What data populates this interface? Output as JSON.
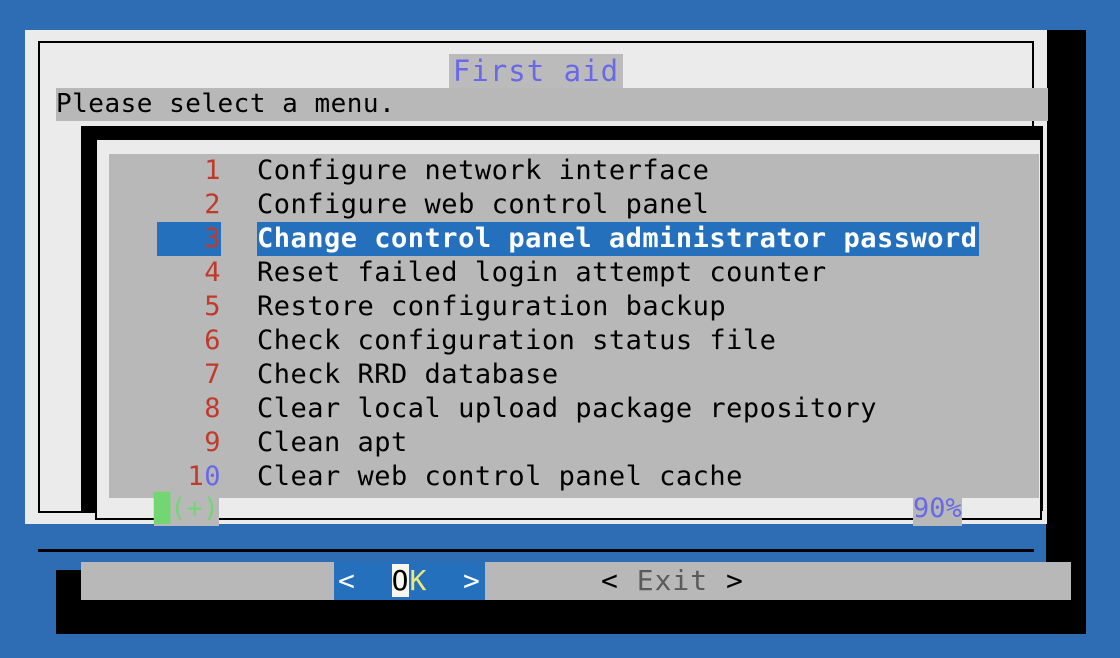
{
  "window": {
    "title": "First aid",
    "prompt": "Please select a menu."
  },
  "colors": {
    "desktop_blue": "#2e6db4",
    "dialog_bg": "#ebebeb",
    "panel_gray": "#b8b8b8",
    "accent_blue": "#2470bd",
    "number_red": "#c03a2b",
    "title_blue": "#6868e8",
    "scroll_green": "#73d673",
    "hotkey_yellow": "#ede87a"
  },
  "menu": {
    "selected_index": 2,
    "items": [
      {
        "number": "1",
        "label": "Configure network interface"
      },
      {
        "number": "2",
        "label": "Configure web control panel"
      },
      {
        "number": "3",
        "label": "Change control panel administrator password"
      },
      {
        "number": "4",
        "label": "Reset failed login attempt counter"
      },
      {
        "number": "5",
        "label": "Restore configuration backup"
      },
      {
        "number": "6",
        "label": "Check configuration status file"
      },
      {
        "number": "7",
        "label": "Check RRD database"
      },
      {
        "number": "8",
        "label": "Clear local upload package repository"
      },
      {
        "number": "9",
        "label": "Clean apt"
      },
      {
        "number": "10",
        "label": "Clear web control panel cache"
      }
    ]
  },
  "scroll": {
    "indicator": "(+)",
    "percent": "90%"
  },
  "buttons": {
    "ok": {
      "left_bracket": "<",
      "hot_letter": "O",
      "rest": "K",
      "right_bracket": ">"
    },
    "exit": {
      "left_bracket": "<",
      "label": "Exit",
      "right_bracket": ">"
    }
  }
}
